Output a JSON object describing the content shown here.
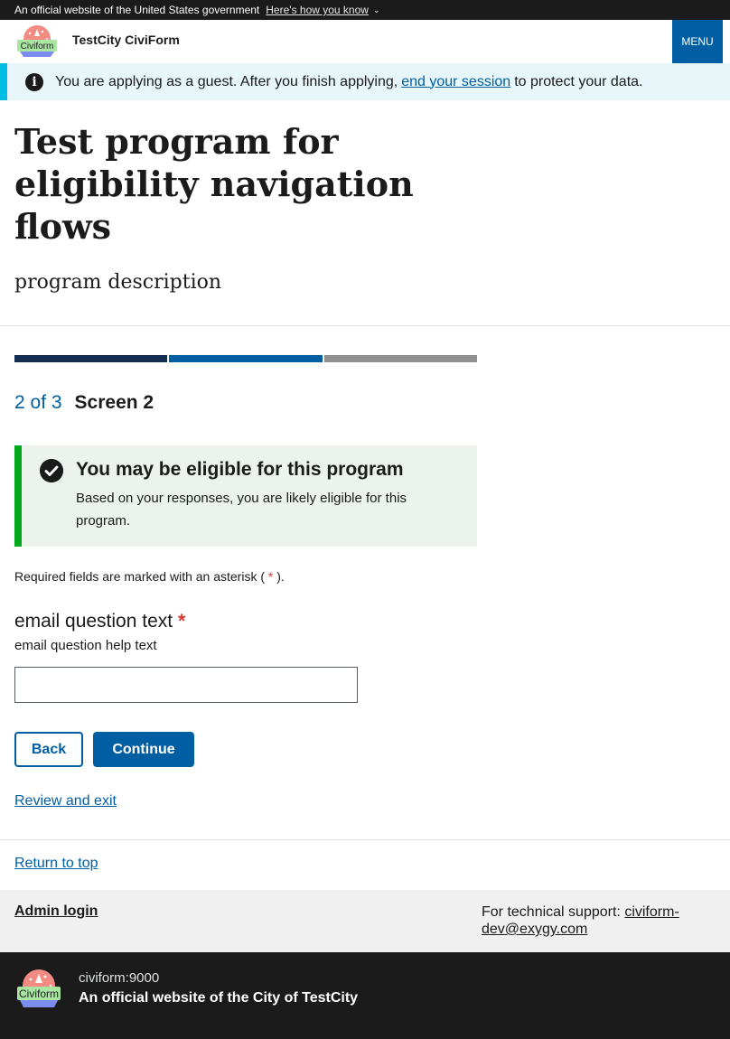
{
  "gov_banner": {
    "text": "An official website of the United States government",
    "link": "Here's how you know"
  },
  "header": {
    "logo_text": "Civiform",
    "site_title": "TestCity CiviForm",
    "menu_label": "MENU"
  },
  "guest_alert": {
    "text_before": "You are applying as a guest. After you finish applying,",
    "link": "end your session",
    "text_after": "to protect your data."
  },
  "program": {
    "title": "Test program for eligibility navigation flows",
    "description": "program description"
  },
  "progress": {
    "segments": [
      {
        "state": "complete",
        "color": "#162e51"
      },
      {
        "state": "current",
        "color": "#005ea2"
      },
      {
        "state": "incomplete",
        "color": "#919191"
      }
    ],
    "step_count": "2 of 3",
    "screen_title": "Screen 2"
  },
  "eligibility_alert": {
    "heading": "You may be eligible for this program",
    "body": "Based on your responses, you are likely eligible for this program."
  },
  "required_note": {
    "before": "Required fields are marked with an asterisk (",
    "asterisk": "*",
    "after": ")."
  },
  "question": {
    "label": "email question text",
    "required_marker": "*",
    "help_text": "email question help text",
    "value": "",
    "placeholder": ""
  },
  "actions": {
    "back_label": "Back",
    "continue_label": "Continue",
    "review_exit_label": "Review and exit"
  },
  "return_to_top": "Return to top",
  "footer": {
    "admin_login": "Admin login",
    "support_label": "For technical support:",
    "support_email": "civiform-dev@exygy.com",
    "logo_text": "Civiform",
    "host": "civiform:9000",
    "official_text": "An official website of the City of TestCity"
  },
  "colors": {
    "primary": "#005ea2",
    "dark": "#1b1b1b",
    "success": "#00a91c",
    "info": "#00bde3",
    "required": "#d83933"
  }
}
